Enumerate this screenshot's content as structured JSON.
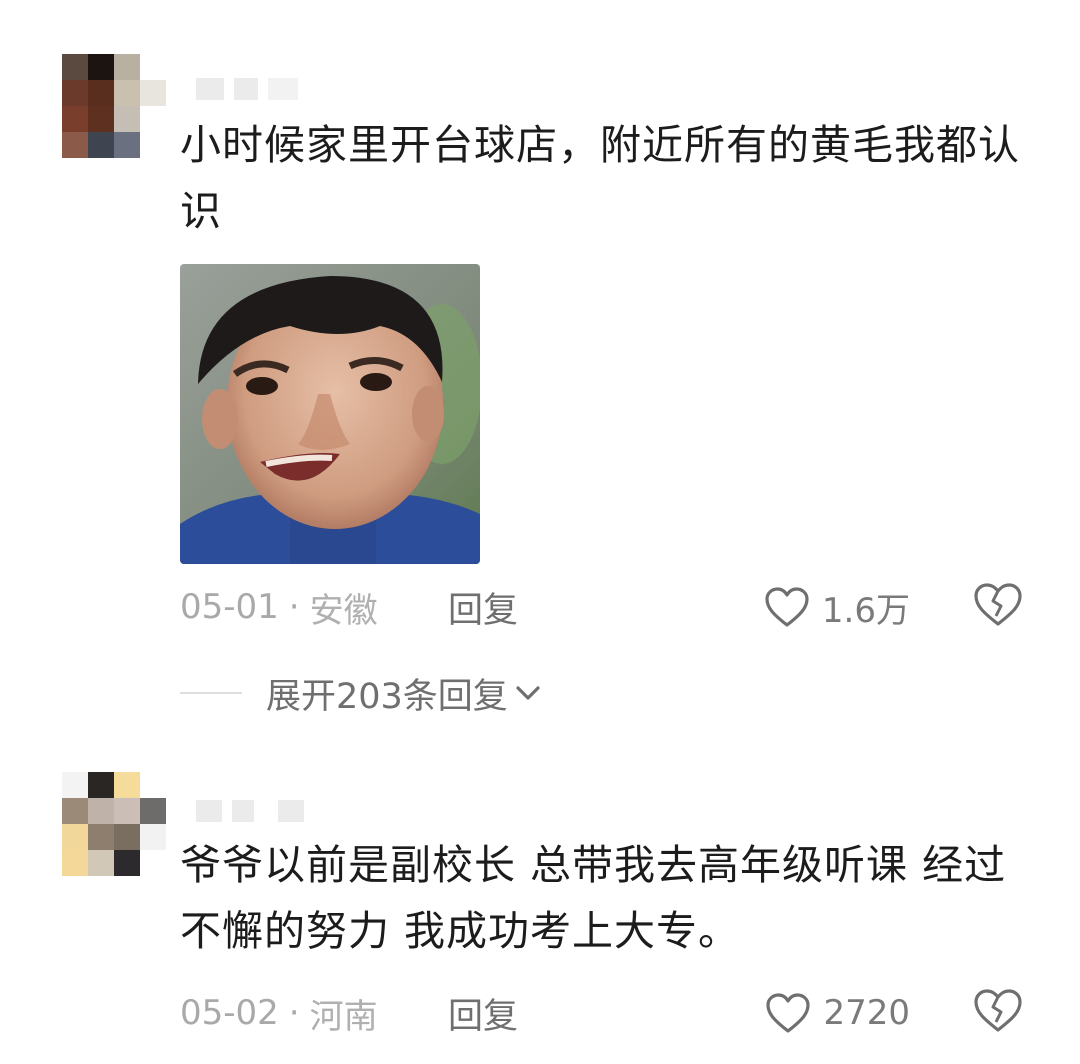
{
  "comments": [
    {
      "text": "小时候家里开台球店，附近所有的黄毛我都认识",
      "date": "05-01",
      "separator": "·",
      "location": "安徽",
      "reply_label": "回复",
      "likes": "1.6万",
      "expand_replies": "展开203条回复"
    },
    {
      "text": "爷爷以前是副校长 总带我去高年级听课 经过不懈的努力 我成功考上大专。",
      "date": "05-02",
      "separator": "·",
      "location": "河南",
      "reply_label": "回复",
      "likes": "2720"
    }
  ],
  "icons": {
    "like": "heart-outline-icon",
    "dislike": "broken-heart-icon",
    "expand": "chevron-down-icon"
  },
  "colors": {
    "text": "#1c1c1c",
    "meta": "#a9a9a9",
    "action": "#6f6f6f"
  }
}
